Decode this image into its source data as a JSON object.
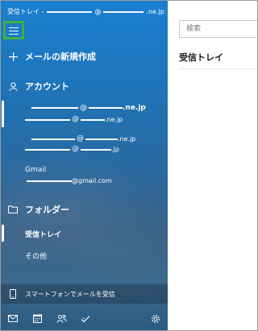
{
  "window": {
    "title_prefix": "受信トレイ -",
    "title_at": "@",
    "title_domain": ".ne.jp"
  },
  "nav": {
    "new_mail_label": "メールの新規作成",
    "accounts_label": "アカウント",
    "accounts": [
      {
        "at": "@",
        "domain": ".ne.jp",
        "selected": true
      },
      {
        "at": "@",
        "domain": ".ne.jp",
        "selected": true
      },
      {
        "at": "@",
        "domain": ".ne.jp",
        "selected": false
      },
      {
        "at": "@",
        "domain": ".jp",
        "selected": false
      }
    ],
    "gmail": {
      "name": "Gmail",
      "address_suffix": "@gmail.com"
    },
    "folders_label": "フォルダー",
    "folders": [
      {
        "label": "受信トレイ",
        "selected": true
      },
      {
        "label": "その他",
        "selected": false
      }
    ],
    "phone_label": "スマートフォンでメールを受信",
    "bottom_icons": [
      "mail-icon",
      "calendar-icon",
      "people-icon",
      "todo-icon",
      "settings-icon"
    ]
  },
  "content": {
    "search_placeholder": "検索",
    "folder_title": "受信トレイ"
  },
  "colors": {
    "nav_blue": "#1a7fd0",
    "highlight": "#3cb043"
  }
}
